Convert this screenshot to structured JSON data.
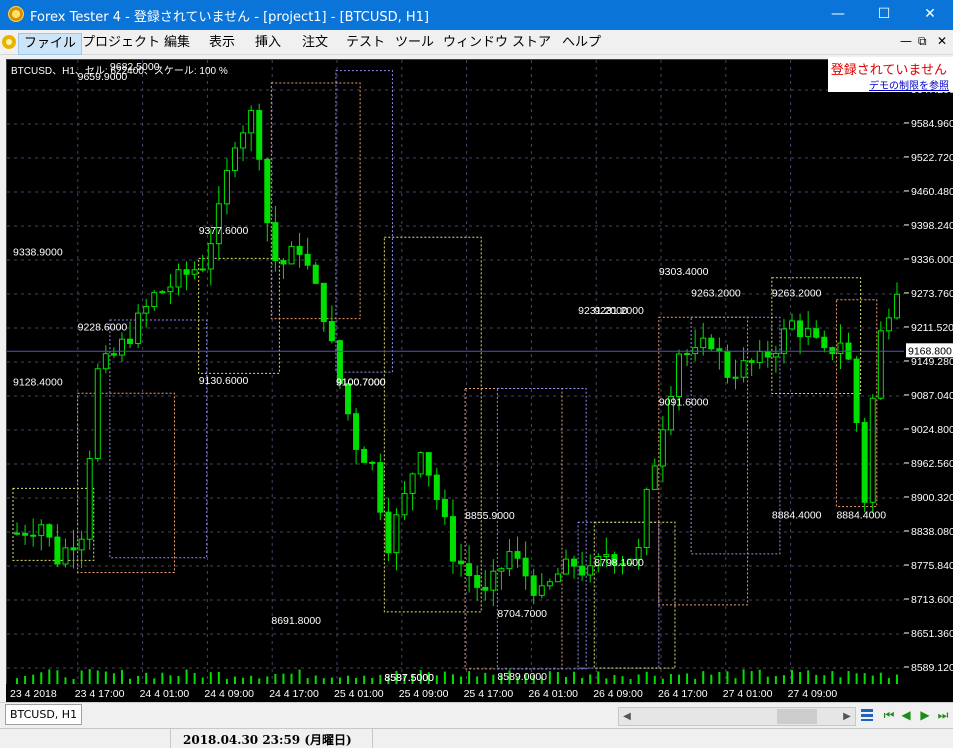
{
  "window": {
    "title": "Forex Tester 4 - 登録されていません - [project1] - [BTCUSD, H1]",
    "minimize": "—",
    "maximize": "☐",
    "close": "✕"
  },
  "menu": [
    "ファイル",
    "プロジェクト",
    "編集",
    "表示",
    "挿入",
    "注文",
    "テスト",
    "ツール",
    "ウィンドウ",
    "ストア",
    "ヘルプ"
  ],
  "mdi_controls": [
    "—",
    "⧉",
    "✕"
  ],
  "notice": {
    "unregistered": "登録されていません",
    "demo_link": "デモの制限を参照"
  },
  "chart_info": "BTCUSD、H1、セル: 622400、スケール: 100 %",
  "chart_data": {
    "type": "candlestick",
    "symbol": "BTCUSD",
    "timeframe": "H1",
    "ylim": [
      8558.0,
      9702.0
    ],
    "y_ticks": [
      "9647.200",
      "9584.960",
      "9522.720",
      "9460.480",
      "9398.240",
      "9336.000",
      "9273.760",
      "9211.520",
      "9149.280",
      "9087.040",
      "9024.800",
      "8962.560",
      "8900.320",
      "8838.080",
      "8775.840",
      "8713.600",
      "8651.360",
      "8589.120"
    ],
    "current_price": "9168.800",
    "x_ticks": [
      "23 4 2018",
      "23 4 17:00",
      "24 4 01:00",
      "24 4 09:00",
      "24 4 17:00",
      "25 4 01:00",
      "25 4 09:00",
      "25 4 17:00",
      "26 4 01:00",
      "26 4 09:00",
      "26 4 17:00",
      "27 4 01:00",
      "27 4 09:00"
    ],
    "grid": true,
    "annotations": [
      {
        "text": "9128.4000",
        "type": "low"
      },
      {
        "text": "9338.9000",
        "type": "high"
      },
      {
        "text": "9228.6000",
        "type": "low"
      },
      {
        "text": "9659.9000",
        "type": "high"
      },
      {
        "text": "9682.5000",
        "type": "high"
      },
      {
        "text": "9130.6000",
        "type": "low"
      },
      {
        "text": "9377.6000",
        "type": "high"
      },
      {
        "text": "8691.8000",
        "type": "low"
      },
      {
        "text": "9100.7000",
        "type": "high"
      },
      {
        "text": "9100.7000",
        "type": "high"
      },
      {
        "text": "8587.5000",
        "type": "low"
      },
      {
        "text": "8587.5000",
        "type": "low"
      },
      {
        "text": "8855.9000",
        "type": "high"
      },
      {
        "text": "8589.0000",
        "type": "low"
      },
      {
        "text": "8704.7000",
        "type": "low"
      },
      {
        "text": "9231.2000",
        "type": "high"
      },
      {
        "text": "9231.2000",
        "type": "high"
      },
      {
        "text": "8798.1000",
        "type": "low"
      },
      {
        "text": "9303.4000",
        "type": "high"
      },
      {
        "text": "9091.6000",
        "type": "low"
      },
      {
        "text": "9263.2000",
        "type": "high"
      },
      {
        "text": "9263.2000",
        "type": "high"
      },
      {
        "text": "8884.4000",
        "type": "low"
      },
      {
        "text": "8884.4000",
        "type": "low"
      }
    ],
    "zones": [
      {
        "high": 8918,
        "low": 8786,
        "color": "#e0e070"
      },
      {
        "high": 9092,
        "low": 8764,
        "color": "#f2a070"
      },
      {
        "high": 9226,
        "low": 8791,
        "color": "#9090f0"
      },
      {
        "high": 9338.9,
        "low": 9128.4,
        "color": "#e0e070"
      },
      {
        "high": 9659.9,
        "low": 9228.6,
        "color": "#f2a070"
      },
      {
        "high": 9682.5,
        "low": 9130.6,
        "color": "#9090f0"
      },
      {
        "high": 9377.6,
        "low": 8691.8,
        "color": "#e0e070"
      },
      {
        "high": 9100.7,
        "low": 8587.5,
        "color": "#f2a070"
      },
      {
        "high": 9100.7,
        "low": 8587.5,
        "color": "#9090f0"
      },
      {
        "high": 8855.9,
        "low": 8589.0,
        "color": "#9090f0"
      },
      {
        "high": 8855.9,
        "low": 8589.0,
        "color": "#e0e070"
      },
      {
        "high": 9231.2,
        "low": 8704.7,
        "color": "#f2a070"
      },
      {
        "high": 9231.2,
        "low": 8798.1,
        "color": "#9090f0"
      },
      {
        "high": 9303.4,
        "low": 9091.6,
        "color": "#e0e070"
      },
      {
        "high": 9263.2,
        "low": 8884.4,
        "color": "#f2a070"
      }
    ]
  },
  "colors": {
    "candle": "#00e000",
    "grid": "#444466",
    "background": "#000000"
  },
  "bottom": {
    "tab": "BTCUSD, H1",
    "datetime": "2018.04.30 23:59 (月曜日)"
  }
}
